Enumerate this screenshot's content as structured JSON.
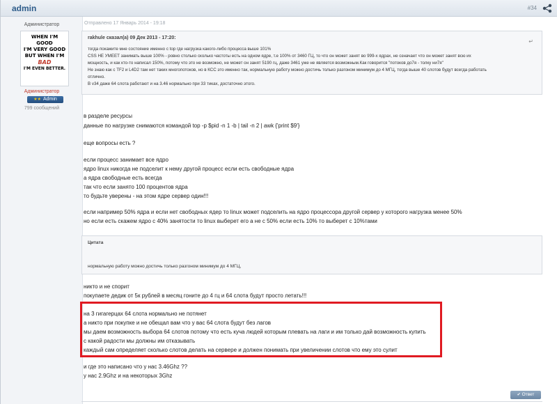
{
  "header": {
    "author": "admin",
    "post_number": "#34"
  },
  "user": {
    "title": "Администратор",
    "avatar_lines": [
      "WHEN I'M GOOD",
      "I'M VERY GOOD",
      "BUT WHEN I'M",
      "BAD",
      "I'M EVEN BETTER."
    ],
    "role_text": "Администратор",
    "badge": "Admin",
    "badge_stars": "★★",
    "message_count": "799 сообщений"
  },
  "post": {
    "sent": "Отправлено 17 Январь 2014 - 19:18",
    "quote": {
      "header": "rakhule сказал(а) 09 Дек 2013 - 17:20:",
      "lines": [
        "тогда покажите мне состояние именно с top где нагрузка какого-либо процесса выше 101%",
        "CSS НЕ УМЕЕТ занимать выше 100% - ровно столько сколько частоты есть на одном ядре, т.е 100% от 3460 ГЦ, то что он может занят во 999-х ядрах, не означает что он может занят всю их",
        "мощность, и как кто-то написал 150%, потому что это не возможно, не может он занят 5190 гц, даже 3461 уже не является возможным.Как говорится \"потоков до7я - толку ни7я\"",
        "Не знаю как с TF2 и L4D2 там нет таких многопотоков, но в КСС это именно так, нормальную работу можно достичь только разгоном минимум до 4 МГЦ, тогда выше 40 слотов будут всегда работать",
        "отлично.",
        "В v34 даже 64 слота работают и на 3.46 нормально при 33 тиках, достаточно этого."
      ]
    },
    "lines": [
      "в разделе ресурсы",
      "данные по нагрузке снимаются командой top -p $pid -n 1 -b | tail -n 2 | awk {'print $9'}",
      "еще вопросы есть ?",
      "если процесс занимает все ядро",
      "ядро linux никогда не подселит к нему другой процесс если есть свободные ядра",
      "а ядра свободные есть всегда",
      "так что если занято 100 процентов ядра",
      "то будьте уверены - на этом ядре сервер один!!!",
      "если например 50% ядра и если нет свободных ядер то linux может подселить на ядро процессора другой сервер у которого нагрузка менее 50%",
      "но если есть скажем ядро с 40% занятости то linux выберет его  а не с 50% если есть 10% то выберет с 10%тами"
    ],
    "quote2": {
      "header": "Цитата",
      "body": "нормальную работу можно достичь только разгоном минимум до 4 МГЦ,"
    },
    "lines2": [
      "никто и не спорит",
      "покупаете дедик от 5к рублей в месяц гоните до 4 гц и 64 слота будут просто летать!!!"
    ],
    "highlight_lines": [
      "на 3 гигагерцах 64 слота нормально не потянет",
      "а никто при покупке и не обещал вам что у вас 64 слота будут без лагов",
      "мы даем возможность выбора 64 слотов потому что есть куча людей которым плевать на лаги и им только дай возможность купить",
      "с какой радости мы должны им отказывать",
      "каждый сам определяет сколько слотов делать на сервере и должен понимать при увеличении слотов что ему это сулит"
    ],
    "lines3": [
      "и где это написано что у нас  3.46Ghz ??",
      "у нас 2.9Ghz и на некоторых 3Ghz"
    ],
    "reply_button": "Ответ"
  }
}
